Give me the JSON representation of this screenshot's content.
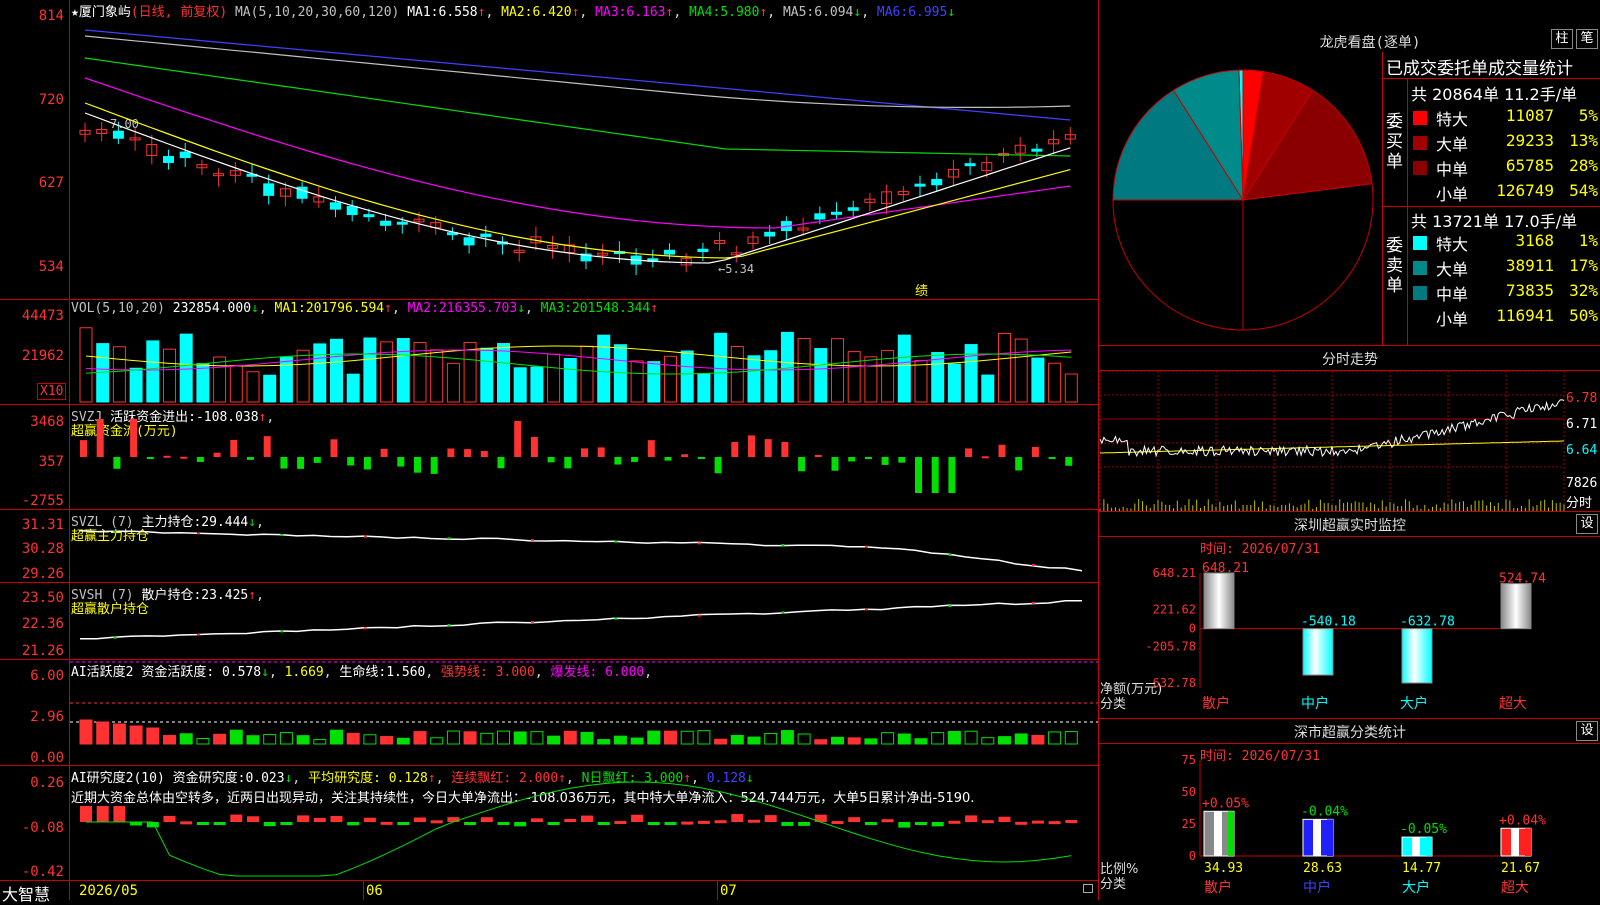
{
  "colors": {
    "up": "#ff3232",
    "down": "#00ffff",
    "green": "#00e000",
    "grid": "#c80000",
    "ma1": "#ffffff",
    "ma2": "#ffff00",
    "ma3": "#ff00ff",
    "ma4": "#00e000",
    "ma5": "#c0c0c0",
    "ma6": "#4040ff"
  },
  "main": {
    "star_icon": "★",
    "stock_name": "厦门象屿",
    "mode": "(日线, 前复权)",
    "ma_label": "MA(5,10,20,30,60,120)",
    "ma": [
      {
        "label": "MA1:",
        "value": "6.558",
        "arrow": "↑"
      },
      {
        "label": "MA2:",
        "value": "6.420",
        "arrow": "↑"
      },
      {
        "label": "MA3:",
        "value": "6.163",
        "arrow": "↑"
      },
      {
        "label": "MA4:",
        "value": "5.980",
        "arrow": "↑"
      },
      {
        "label": "MA5:",
        "value": "6.094",
        "arrow": "↓"
      },
      {
        "label": "MA6:",
        "value": "6.995",
        "arrow": "↓"
      }
    ],
    "yticks": [
      "814",
      "720",
      "627",
      "534"
    ],
    "hi_label": "7.00",
    "lo_label": "←5.34",
    "note": "绩"
  },
  "vol": {
    "label": "VOL(5,10,20)",
    "value": "232854.000",
    "arrow": "↓",
    "ma": [
      {
        "label": "MA1:",
        "value": "201796.594",
        "arrow": "↑"
      },
      {
        "label": "MA2:",
        "value": "216355.703",
        "arrow": "↓"
      },
      {
        "label": "MA3:",
        "value": "201548.344",
        "arrow": "↑"
      }
    ],
    "yticks": [
      "44473",
      "21962"
    ],
    "unit": "X10"
  },
  "svzj": {
    "label": "SVZJ",
    "desc": "活跃资金进出:",
    "value": "-108.038",
    "arrow": "↑",
    "name": "超赢资金流(万元)",
    "yticks": [
      "3468",
      "357",
      "-2755"
    ]
  },
  "svzl": {
    "label": "SVZL (7)",
    "desc": "主力持仓:",
    "value": "29.444",
    "arrow": "↓",
    "name": "超赢主力持仓",
    "yticks": [
      "31.31",
      "30.28",
      "29.26"
    ]
  },
  "svsh": {
    "label": "SVSH (7)",
    "desc": "散户持仓:",
    "value": "23.425",
    "arrow": "↑",
    "name": "超赢散户持仓",
    "yticks": [
      "23.50",
      "22.36",
      "21.26"
    ]
  },
  "ai1": {
    "label": "AI活跃度2",
    "desc": "资金活跃度:",
    "value1": "0.578",
    "value2": "1.669",
    "life_label": "生命线:",
    "life": "1.560",
    "strong": "强势线: 3.000",
    "burst": "爆发线: 6.000",
    "yticks": [
      "6.00",
      "2.96",
      "0.00"
    ]
  },
  "ai2": {
    "label": "AI研究度2(10)",
    "desc": "资金研究度:",
    "v1": "0.023",
    "avg": "平均研究度: 0.128",
    "cont": "连续飘红: 2.000",
    "n": "N日飘红: 3.000",
    "v2": "0.128",
    "summary": "近期大资金总体由空转多，近两日出现异动，关注其持续性，今日大单净流出：-108.036万元，其中特大单净流入：524.744万元，大单5日累计净出-5190.",
    "yticks": [
      "0.26",
      "-0.08",
      "-0.42"
    ]
  },
  "xaxis": {
    "brand": "大智慧",
    "labels": [
      "2026/05",
      "06",
      "07"
    ]
  },
  "lhb": {
    "title": "龙虎看盘(逐单)",
    "btn1": "柱",
    "btn2": "笔",
    "stat_title": "已成交委托单成交量统计",
    "buy": {
      "header": "共 20864单 11.2手/单",
      "side": "委买单",
      "rows": [
        {
          "name": "特大",
          "vol": "11087",
          "pct": "5%"
        },
        {
          "name": "大单",
          "vol": "29233",
          "pct": "13%"
        },
        {
          "name": "中单",
          "vol": "65785",
          "pct": "28%"
        },
        {
          "name": "小单",
          "vol": "126749",
          "pct": "54%"
        }
      ]
    },
    "sell": {
      "header": "共 13721单 17.0手/单",
      "side": "委卖单",
      "rows": [
        {
          "name": "特大",
          "vol": "3168",
          "pct": "1%"
        },
        {
          "name": "大单",
          "vol": "38911",
          "pct": "17%"
        },
        {
          "name": "中单",
          "vol": "73835",
          "pct": "32%"
        },
        {
          "name": "小单",
          "vol": "116941",
          "pct": "50%"
        }
      ]
    }
  },
  "fenshi": {
    "title": "分时走势",
    "yticks": [
      "6.78",
      "6.71",
      "6.64"
    ],
    "vol_label": "7826",
    "vol_unit": "分时"
  },
  "sz": {
    "title": "深圳超赢实时监控",
    "btn": "设",
    "time": "时间: 2026/07/31",
    "yticks": [
      "648.21",
      "221.62",
      "0",
      "-205.78",
      "-632.78"
    ],
    "unit": "净额(万元)",
    "cat_label": "分类",
    "bars": [
      {
        "name": "散户",
        "value": 648.21,
        "label": "648.21"
      },
      {
        "name": "中户",
        "value": -540.18,
        "label": "-540.18"
      },
      {
        "name": "大户",
        "value": -632.78,
        "label": "-632.78"
      },
      {
        "name": "超大",
        "value": 524.74,
        "label": "524.74"
      }
    ]
  },
  "ss": {
    "title": "深市超赢分类统计",
    "btn": "设",
    "time": "时间: 2026/07/31",
    "yticks": [
      "75",
      "50",
      "25",
      "0"
    ],
    "unit": "比例%",
    "cat_label": "分类",
    "bars": [
      {
        "name": "散户",
        "value": 34.93,
        "change": "+0.05%"
      },
      {
        "name": "中户",
        "value": 28.63,
        "change": "-0.04%"
      },
      {
        "name": "大户",
        "value": 14.77,
        "change": "-0.05%"
      },
      {
        "name": "超大",
        "value": 21.67,
        "change": "+0.04%"
      }
    ]
  }
}
